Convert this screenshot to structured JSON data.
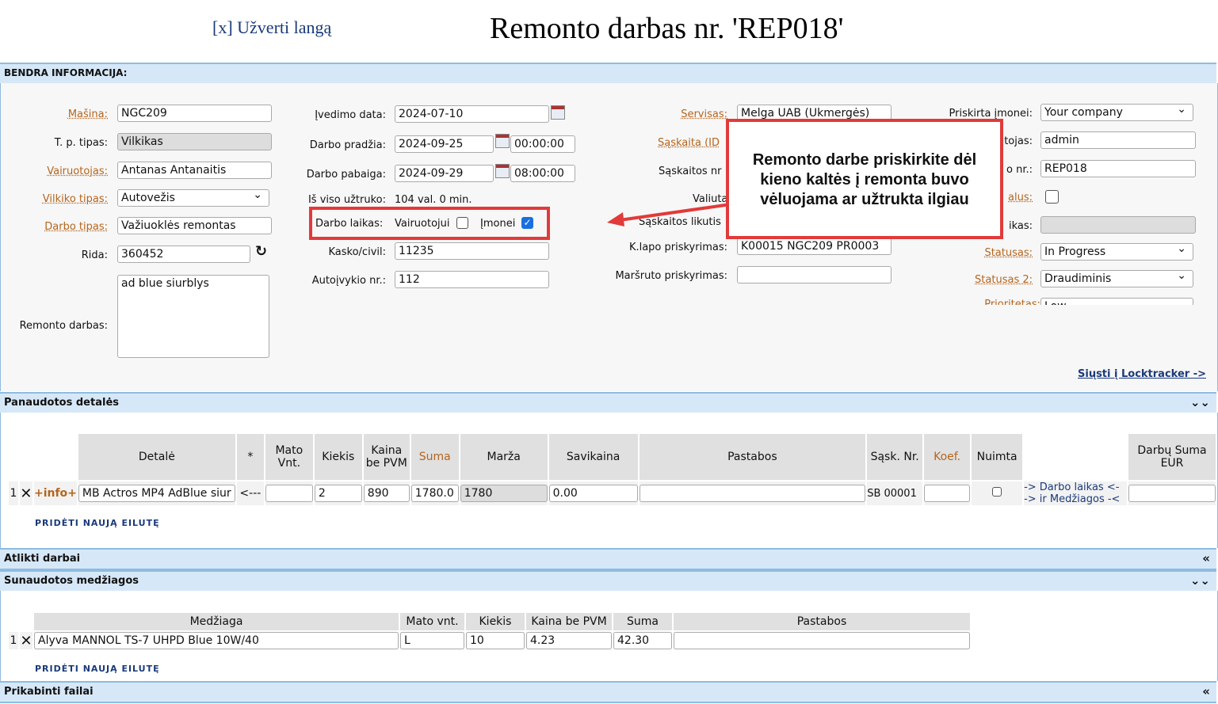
{
  "header": {
    "close_label": "[x] Užverti langą",
    "title": "Remonto darbas nr. 'REP018'"
  },
  "general": {
    "section_title": "BENDRA INFORMACIJA:",
    "col1": {
      "masina_label": "Mašina:",
      "masina_value": "NGC209",
      "tp_label": "T. p. tipas:",
      "tp_value": "Vilkikas",
      "vairuotojas_label": "Vairuotojas:",
      "vairuotojas_value": "Antanas Antanaitis",
      "vilkiko_label": "Vilkiko tipas:",
      "vilkiko_value": "Autovežis",
      "darbo_tipas_label": "Darbo tipas:",
      "darbo_tipas_value": "Važiuoklės remontas",
      "rida_label": "Rida:",
      "rida_value": "360452",
      "remonto_label": "Remonto darbas:",
      "remonto_value": "ad blue siurblys"
    },
    "col2": {
      "ivedimo_label": "Įvedimo data:",
      "ivedimo_value": "2024-07-10",
      "pradzia_label": "Darbo pradžia:",
      "pradzia_date": "2024-09-25",
      "pradzia_time": "00:00:00",
      "pabaiga_label": "Darbo pabaiga:",
      "pabaiga_date": "2024-09-29",
      "pabaiga_time": "08:00:00",
      "viso_label": "Iš viso užtruko:",
      "viso_value": "104 val. 0 min.",
      "laikas_label": "Darbo laikas:",
      "vairuotojui_label": "Vairuotojui",
      "imonei_label": "Įmonei",
      "kasko_label": "Kasko/civil:",
      "kasko_value": "11235",
      "autoivykio_label": "Autoįvykio nr.:",
      "autoivykio_value": "112"
    },
    "col3": {
      "servisas_label": "Servisas:",
      "servisas_value": "Melga UAB (Ukmergės)",
      "saskaita_label": "Sąskaita (ID",
      "saskaitos_nr_label": "Sąskaitos nr",
      "valiuta_label": "Valiuta",
      "likutis_label": "Sąskaitos likutis",
      "klapo_label": "K.lapo priskyrimas:",
      "klapo_value": "K00015 NGC209  PR0003",
      "marsruto_label": "Maršruto priskyrimas:"
    },
    "col4": {
      "priskirta_label": "Priskirta įmonei:",
      "priskirta_value": "Your company",
      "atsakingas_label": "tojas:",
      "atsakingas_value": "admin",
      "nr_label": "o nr.:",
      "nr_value": "REP018",
      "alus_label": "alus:",
      "ikas_label": "ikas:",
      "statusas_label": "Statusas:",
      "statusas_value": "In Progress",
      "statusas2_label": "Statusas 2:",
      "statusas2_value": "Draudiminis",
      "prioritetas_label": "Prioritetas:",
      "prioritetas_value": "Low"
    },
    "send_link": "Siųsti į Locktracker ->"
  },
  "callout": {
    "line1": "Remonto darbe priskirkite dėl",
    "line2": "kieno kaltės į remonta buvo",
    "line3": "vėluojama ar užtrukta ilgiau"
  },
  "parts": {
    "section_title": "Panaudotos detalės",
    "headers": [
      "Detalė",
      "*",
      "Mato Vnt.",
      "Kiekis",
      "Kaina be PVM",
      "Suma",
      "Marža",
      "Savikaina",
      "Pastabos",
      "Sąsk. Nr.",
      "Koef.",
      "Nuimta",
      "",
      "Darbų Suma EUR"
    ],
    "row": {
      "num": "1",
      "info": "+info+",
      "detale": "MB Actros MP4 AdBlue siur",
      "arrow": "<---",
      "mato": "",
      "kiekis": "2",
      "kaina": "890",
      "suma": "1780.0",
      "marza": "1780",
      "savikaina": "0.00",
      "pastabos": "",
      "sask": "SB 00001",
      "koef": "",
      "link1": "-> Darbo laikas <-",
      "link2": "-> ir Medžiagos -<",
      "darbu": ""
    },
    "add_row": "PRIDĖTI NAUJĄ EILUTĘ"
  },
  "works": {
    "section_title": "Atlikti darbai"
  },
  "materials": {
    "section_title": "Sunaudotos medžiagos",
    "headers": [
      "Medžiaga",
      "Mato vnt.",
      "Kiekis",
      "Kaina be PVM",
      "Suma",
      "Pastabos"
    ],
    "row": {
      "num": "1",
      "medziaga": "Alyva MANNOL TS-7 UHPD Blue 10W/40",
      "mato": "L",
      "kiekis": "10",
      "kaina": "4.23",
      "suma": "42.30",
      "pastabos": ""
    },
    "add_row": "PRIDĖTI NAUJĄ EILUTĘ"
  },
  "files": {
    "section_title": "Prikabinti failai"
  },
  "colors": {
    "accent": "#e23a3a",
    "section_bg": "#d6e8f8",
    "link": "#1a3a7a",
    "required_label": "#b5651d"
  }
}
